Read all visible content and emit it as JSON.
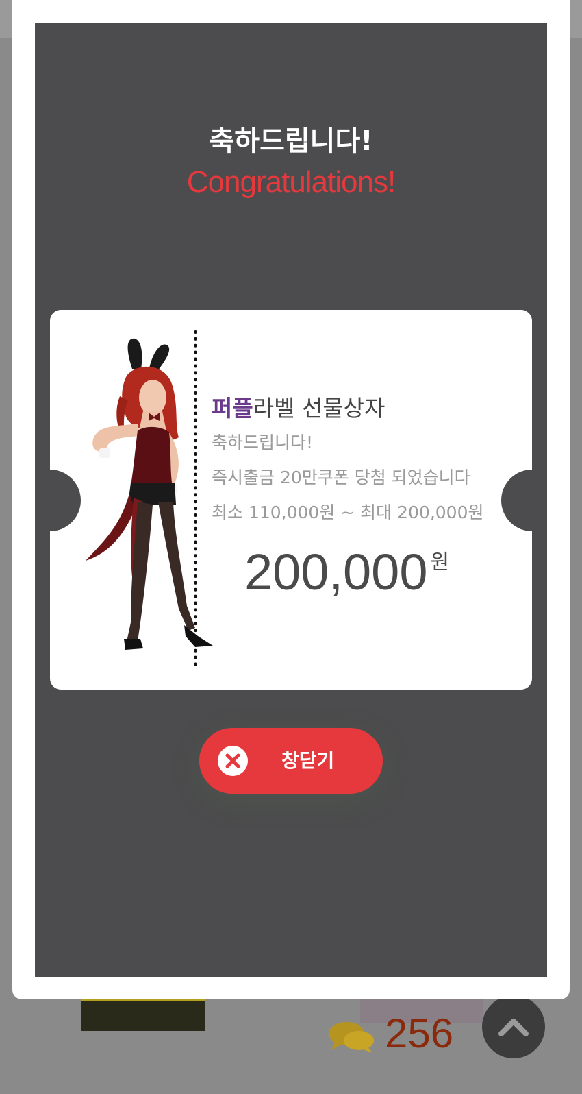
{
  "modal": {
    "title_ko": "축하드립니다!",
    "title_en": "Congratulations!",
    "close_label": "창닫기"
  },
  "ticket": {
    "brand_strong": "퍼플",
    "product_name_rest": "라벨 선물상자",
    "line1": "축하드립니다!",
    "line2": "즉시출금 20만쿠폰 당첨 되었습니다",
    "line3": "최소 110,000원 ~ 최대 200,000원",
    "amount": "200,000",
    "amount_unit": "원"
  },
  "background": {
    "comment_count": "256"
  },
  "colors": {
    "accent": "#e5393e",
    "brand_purple": "#6a3a8c",
    "modal_bg": "#4c4b4d"
  },
  "icons": {
    "close": "close-icon",
    "chat": "chat-bubbles-icon",
    "scroll_top": "chevron-up-icon",
    "character": "character-illustration"
  }
}
